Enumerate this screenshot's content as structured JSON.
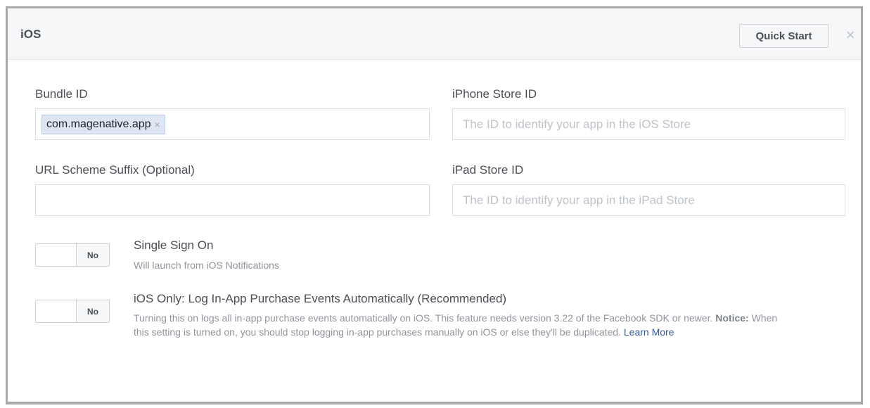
{
  "panel": {
    "title": "iOS",
    "quick_start_label": "Quick Start",
    "close_icon": "×"
  },
  "fields": {
    "bundle_id": {
      "label": "Bundle ID",
      "token": "com.magenative.app",
      "token_remove": "×"
    },
    "iphone_store_id": {
      "label": "iPhone Store ID",
      "placeholder": "The ID to identify your app in the iOS Store",
      "value": ""
    },
    "url_scheme_suffix": {
      "label": "URL Scheme Suffix (Optional)",
      "value": ""
    },
    "ipad_store_id": {
      "label": "iPad Store ID",
      "placeholder": "The ID to identify your app in the iPad Store",
      "value": ""
    }
  },
  "options": {
    "single_sign_on": {
      "toggle_label": "No",
      "title": "Single Sign On",
      "description": "Will launch from iOS Notifications"
    },
    "log_iap": {
      "toggle_label": "No",
      "title": "iOS Only: Log In-App Purchase Events Automatically (Recommended)",
      "description_part1": "Turning this on logs all in-app purchase events automatically on iOS. This feature needs version 3.22 of the Facebook SDK or newer. ",
      "notice_label": "Notice:",
      "description_part2": " When this setting is turned on, you should stop logging in-app purchases manually on iOS or else they'll be duplicated. ",
      "learn_more": "Learn More"
    }
  }
}
